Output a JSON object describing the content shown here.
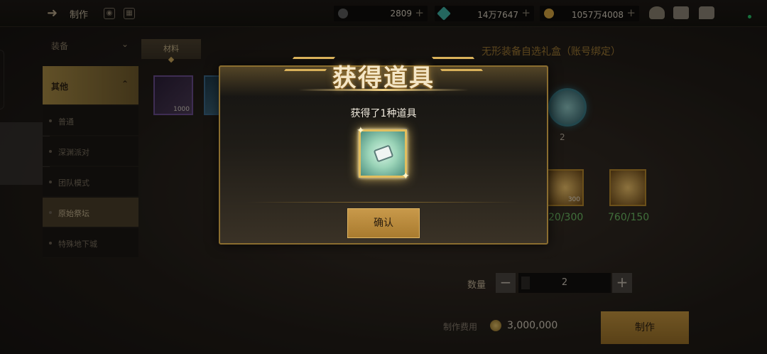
{
  "header": {
    "title": "制作"
  },
  "currencies": [
    {
      "name": "currency-1",
      "value": "2809",
      "color": "#6a6a6a"
    },
    {
      "name": "currency-2",
      "value": "14万7647",
      "color": "#3fb2a4"
    },
    {
      "name": "currency-3",
      "value": "1057万4008",
      "color": "#d4a440"
    }
  ],
  "sidebar": {
    "equip": "装备",
    "other": "其他",
    "items": [
      "普通",
      "深渊派对",
      "团队模式",
      "原始祭坛",
      "特殊地下城"
    ]
  },
  "main": {
    "tab": "材料",
    "material_count": "1000",
    "right_title": "无形装备自选礼盒（账号绑定）",
    "circle_count": "2",
    "sq1_count": "300",
    "ratio1": "20/300",
    "ratio2": "760/150",
    "qty_label": "数量",
    "qty_value": "2",
    "cost_label": "制作费用",
    "cost_value": "3,000,000",
    "craft_button": "制作"
  },
  "modal": {
    "banner": "获得道具",
    "message": "获得了1种道具",
    "confirm": "确认"
  }
}
